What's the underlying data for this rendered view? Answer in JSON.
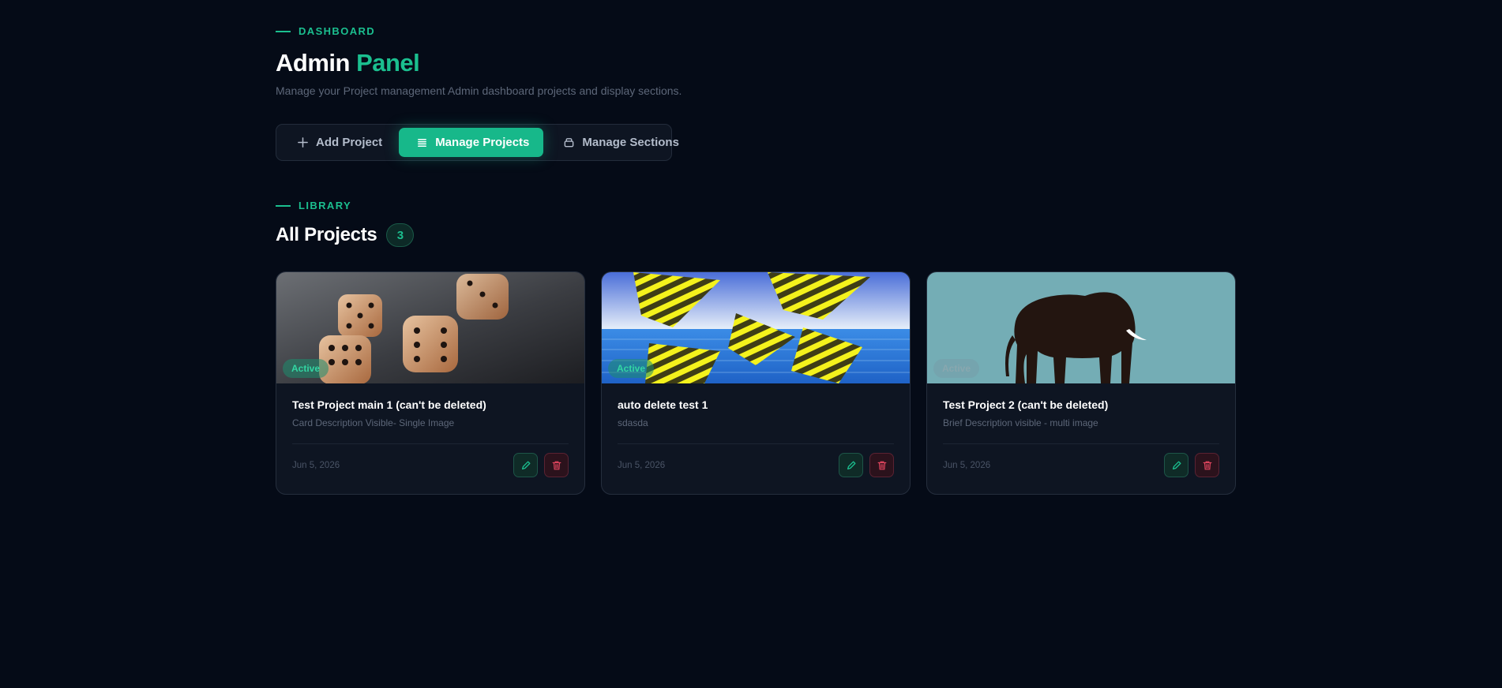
{
  "header": {
    "eyebrow": "DASHBOARD",
    "title_main": "Admin",
    "title_accent": "Panel",
    "subtitle": "Manage your Project management Admin dashboard projects and display sections."
  },
  "toolbar": {
    "add_label": "Add Project",
    "manage_projects_label": "Manage Projects",
    "manage_sections_label": "Manage Sections",
    "active_tab": "Manage Projects"
  },
  "library": {
    "eyebrow": "LIBRARY",
    "title": "All Projects",
    "count": "3"
  },
  "projects": [
    {
      "title": "Test Project main 1 (can't be deleted)",
      "description": "Card Description Visible- Single Image",
      "status": "Active",
      "date": "Jun 5, 2026",
      "image_icon": "dice-image"
    },
    {
      "title": "auto delete test 1",
      "description": "sdasda",
      "status": "Active",
      "date": "Jun 5, 2026",
      "image_icon": "yellow-striped-pyramids-image"
    },
    {
      "title": "Test Project 2 (can't be deleted)",
      "description": "Brief Description visible - multi image",
      "status": "Active",
      "date": "Jun 5, 2026",
      "image_icon": "elephant-silhouette-image"
    }
  ],
  "colors": {
    "background": "#050b17",
    "accent": "#1bbf8f",
    "card": "#0e1522",
    "danger": "#e0455e"
  }
}
